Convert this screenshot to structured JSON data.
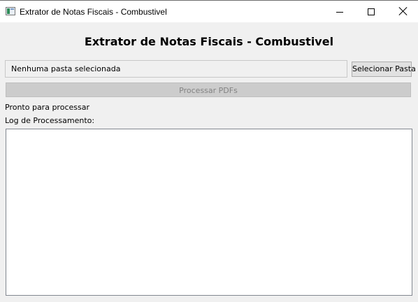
{
  "window": {
    "title": "Extrator de Notas Fiscais - Combustivel",
    "icon": "app-window-icon"
  },
  "header": {
    "title": "Extrator de Notas Fiscais - Combustivel"
  },
  "folder": {
    "path_text": "Nenhuma pasta selecionada",
    "select_label": "Selecionar Pasta"
  },
  "process": {
    "button_label": "Processar PDFs",
    "enabled": false
  },
  "status": {
    "text": "Pronto para processar"
  },
  "log": {
    "label": "Log de Processamento:",
    "content": ""
  },
  "colors": {
    "background": "#f0f0f0",
    "disabled_button": "#cccccc",
    "disabled_text": "#838383"
  }
}
